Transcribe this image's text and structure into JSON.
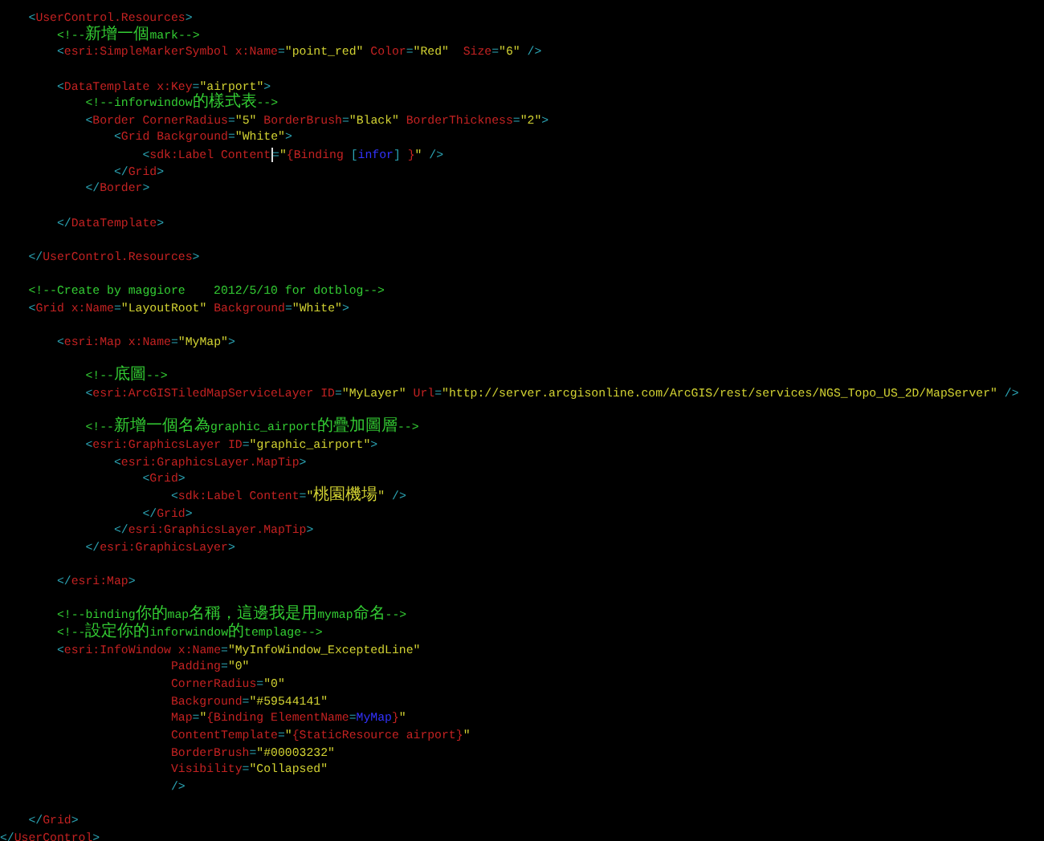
{
  "editor": {
    "lines": [
      {
        "kind": "code",
        "segments": [
          {
            "kind": "punct",
            "text": "    <"
          },
          {
            "kind": "tag",
            "text": "UserControl.Resources"
          },
          {
            "kind": "punct",
            "text": ">"
          }
        ]
      },
      {
        "kind": "code",
        "segments": [
          {
            "kind": "comment",
            "text": "        <!--新增一個mark-->"
          }
        ]
      },
      {
        "kind": "code",
        "segments": [
          {
            "kind": "punct",
            "text": "        <"
          },
          {
            "kind": "tag",
            "text": "esri:SimpleMarkerSymbol"
          },
          {
            "kind": "attr",
            "text": " x:Name"
          },
          {
            "kind": "punct",
            "text": "="
          },
          {
            "kind": "value",
            "text": "\"point_red\""
          },
          {
            "kind": "attr",
            "text": " Color"
          },
          {
            "kind": "punct",
            "text": "="
          },
          {
            "kind": "value",
            "text": "\"Red\""
          },
          {
            "kind": "attr",
            "text": "  Size"
          },
          {
            "kind": "punct",
            "text": "="
          },
          {
            "kind": "value",
            "text": "\"6\""
          },
          {
            "kind": "punct",
            "text": " />"
          }
        ]
      },
      {
        "kind": "blank"
      },
      {
        "kind": "code",
        "segments": [
          {
            "kind": "punct",
            "text": "        <"
          },
          {
            "kind": "tag",
            "text": "DataTemplate"
          },
          {
            "kind": "attr",
            "text": " x:Key"
          },
          {
            "kind": "punct",
            "text": "="
          },
          {
            "kind": "value",
            "text": "\"airport\""
          },
          {
            "kind": "punct",
            "text": ">"
          }
        ]
      },
      {
        "kind": "code",
        "segments": [
          {
            "kind": "comment",
            "text": "            <!--inforwindow的樣式表-->"
          }
        ]
      },
      {
        "kind": "code",
        "segments": [
          {
            "kind": "punct",
            "text": "            <"
          },
          {
            "kind": "tag",
            "text": "Border"
          },
          {
            "kind": "attr",
            "text": " CornerRadius"
          },
          {
            "kind": "punct",
            "text": "="
          },
          {
            "kind": "value",
            "text": "\"5\""
          },
          {
            "kind": "attr",
            "text": " BorderBrush"
          },
          {
            "kind": "punct",
            "text": "="
          },
          {
            "kind": "value",
            "text": "\"Black\""
          },
          {
            "kind": "attr",
            "text": " BorderThickness"
          },
          {
            "kind": "punct",
            "text": "="
          },
          {
            "kind": "value",
            "text": "\"2\""
          },
          {
            "kind": "punct",
            "text": ">"
          }
        ]
      },
      {
        "kind": "code",
        "segments": [
          {
            "kind": "punct",
            "text": "                <"
          },
          {
            "kind": "tag",
            "text": "Grid"
          },
          {
            "kind": "attr",
            "text": " Background"
          },
          {
            "kind": "punct",
            "text": "="
          },
          {
            "kind": "value",
            "text": "\"White\""
          },
          {
            "kind": "punct",
            "text": ">"
          }
        ]
      },
      {
        "kind": "code",
        "segments": [
          {
            "kind": "punct",
            "text": "                    <"
          },
          {
            "kind": "tag",
            "text": "sdk:Label"
          },
          {
            "kind": "attr",
            "text": " Content"
          },
          {
            "kind": "caret"
          },
          {
            "kind": "punct",
            "text": "="
          },
          {
            "kind": "value",
            "text": "\""
          },
          {
            "kind": "attr",
            "text": "{Binding "
          },
          {
            "kind": "punct",
            "text": "["
          },
          {
            "kind": "ref",
            "text": "infor"
          },
          {
            "kind": "punct",
            "text": "]"
          },
          {
            "kind": "attr",
            "text": " }"
          },
          {
            "kind": "value",
            "text": "\""
          },
          {
            "kind": "punct",
            "text": " />"
          }
        ]
      },
      {
        "kind": "code",
        "segments": [
          {
            "kind": "punct",
            "text": "                </"
          },
          {
            "kind": "tag",
            "text": "Grid"
          },
          {
            "kind": "punct",
            "text": ">"
          }
        ]
      },
      {
        "kind": "code",
        "segments": [
          {
            "kind": "punct",
            "text": "            </"
          },
          {
            "kind": "tag",
            "text": "Border"
          },
          {
            "kind": "punct",
            "text": ">"
          }
        ]
      },
      {
        "kind": "blank"
      },
      {
        "kind": "code",
        "segments": [
          {
            "kind": "punct",
            "text": "        </"
          },
          {
            "kind": "tag",
            "text": "DataTemplate"
          },
          {
            "kind": "punct",
            "text": ">"
          }
        ]
      },
      {
        "kind": "blank"
      },
      {
        "kind": "code",
        "segments": [
          {
            "kind": "punct",
            "text": "    </"
          },
          {
            "kind": "tag",
            "text": "UserControl.Resources"
          },
          {
            "kind": "punct",
            "text": ">"
          }
        ]
      },
      {
        "kind": "blank"
      },
      {
        "kind": "code",
        "segments": [
          {
            "kind": "comment",
            "text": "    <!--Create by maggiore    2012/5/10 for dotblog-->"
          }
        ]
      },
      {
        "kind": "code",
        "segments": [
          {
            "kind": "punct",
            "text": "    <"
          },
          {
            "kind": "tag",
            "text": "Grid"
          },
          {
            "kind": "attr",
            "text": " x:Name"
          },
          {
            "kind": "punct",
            "text": "="
          },
          {
            "kind": "value",
            "text": "\"LayoutRoot\""
          },
          {
            "kind": "attr",
            "text": " Background"
          },
          {
            "kind": "punct",
            "text": "="
          },
          {
            "kind": "value",
            "text": "\"White\""
          },
          {
            "kind": "punct",
            "text": ">"
          }
        ]
      },
      {
        "kind": "blank"
      },
      {
        "kind": "code",
        "segments": [
          {
            "kind": "punct",
            "text": "        <"
          },
          {
            "kind": "tag",
            "text": "esri:Map"
          },
          {
            "kind": "attr",
            "text": " x:Name"
          },
          {
            "kind": "punct",
            "text": "="
          },
          {
            "kind": "value",
            "text": "\"MyMap\""
          },
          {
            "kind": "punct",
            "text": ">"
          }
        ]
      },
      {
        "kind": "blank"
      },
      {
        "kind": "code",
        "segments": [
          {
            "kind": "comment",
            "text": "            <!--底圖-->"
          }
        ]
      },
      {
        "kind": "code",
        "segments": [
          {
            "kind": "punct",
            "text": "            <"
          },
          {
            "kind": "tag",
            "text": "esri:ArcGISTiledMapServiceLayer"
          },
          {
            "kind": "attr",
            "text": " ID"
          },
          {
            "kind": "punct",
            "text": "="
          },
          {
            "kind": "value",
            "text": "\"MyLayer\""
          },
          {
            "kind": "attr",
            "text": " Url"
          },
          {
            "kind": "punct",
            "text": "="
          },
          {
            "kind": "value",
            "text": "\"http://server.arcgisonline.com/ArcGIS/rest/services/NGS_Topo_US_2D/MapServer\""
          },
          {
            "kind": "punct",
            "text": " />"
          }
        ]
      },
      {
        "kind": "blank"
      },
      {
        "kind": "code",
        "segments": [
          {
            "kind": "comment",
            "text": "            <!--新增一個名為graphic_airport的疊加圖層-->"
          }
        ]
      },
      {
        "kind": "code",
        "segments": [
          {
            "kind": "punct",
            "text": "            <"
          },
          {
            "kind": "tag",
            "text": "esri:GraphicsLayer"
          },
          {
            "kind": "attr",
            "text": " ID"
          },
          {
            "kind": "punct",
            "text": "="
          },
          {
            "kind": "value",
            "text": "\"graphic_airport\""
          },
          {
            "kind": "punct",
            "text": ">"
          }
        ]
      },
      {
        "kind": "code",
        "segments": [
          {
            "kind": "punct",
            "text": "                <"
          },
          {
            "kind": "tag",
            "text": "esri:GraphicsLayer.MapTip"
          },
          {
            "kind": "punct",
            "text": ">"
          }
        ]
      },
      {
        "kind": "code",
        "segments": [
          {
            "kind": "punct",
            "text": "                    <"
          },
          {
            "kind": "tag",
            "text": "Grid"
          },
          {
            "kind": "punct",
            "text": ">"
          }
        ]
      },
      {
        "kind": "code",
        "segments": [
          {
            "kind": "punct",
            "text": "                        <"
          },
          {
            "kind": "tag",
            "text": "sdk:Label"
          },
          {
            "kind": "attr",
            "text": " Content"
          },
          {
            "kind": "punct",
            "text": "="
          },
          {
            "kind": "value",
            "text": "\"桃園機場\""
          },
          {
            "kind": "punct",
            "text": " />"
          }
        ]
      },
      {
        "kind": "code",
        "segments": [
          {
            "kind": "punct",
            "text": "                    </"
          },
          {
            "kind": "tag",
            "text": "Grid"
          },
          {
            "kind": "punct",
            "text": ">"
          }
        ]
      },
      {
        "kind": "code",
        "segments": [
          {
            "kind": "punct",
            "text": "                </"
          },
          {
            "kind": "tag",
            "text": "esri:GraphicsLayer.MapTip"
          },
          {
            "kind": "punct",
            "text": ">"
          }
        ]
      },
      {
        "kind": "code",
        "segments": [
          {
            "kind": "punct",
            "text": "            </"
          },
          {
            "kind": "tag",
            "text": "esri:GraphicsLayer"
          },
          {
            "kind": "punct",
            "text": ">"
          }
        ]
      },
      {
        "kind": "blank"
      },
      {
        "kind": "code",
        "segments": [
          {
            "kind": "punct",
            "text": "        </"
          },
          {
            "kind": "tag",
            "text": "esri:Map"
          },
          {
            "kind": "punct",
            "text": ">"
          }
        ]
      },
      {
        "kind": "blank"
      },
      {
        "kind": "code",
        "segments": [
          {
            "kind": "comment",
            "text": "        <!--binding你的map名稱，這邊我是用mymap命名-->"
          }
        ]
      },
      {
        "kind": "code",
        "segments": [
          {
            "kind": "comment",
            "text": "        <!--設定你的inforwindow的templage-->"
          }
        ]
      },
      {
        "kind": "code",
        "segments": [
          {
            "kind": "punct",
            "text": "        <"
          },
          {
            "kind": "tag",
            "text": "esri:InfoWindow"
          },
          {
            "kind": "attr",
            "text": " x:Name"
          },
          {
            "kind": "punct",
            "text": "="
          },
          {
            "kind": "value",
            "text": "\"MyInfoWindow_ExceptedLine\""
          }
        ]
      },
      {
        "kind": "code",
        "segments": [
          {
            "kind": "attr",
            "text": "                        Padding"
          },
          {
            "kind": "punct",
            "text": "="
          },
          {
            "kind": "value",
            "text": "\"0\""
          }
        ]
      },
      {
        "kind": "code",
        "segments": [
          {
            "kind": "attr",
            "text": "                        CornerRadius"
          },
          {
            "kind": "punct",
            "text": "="
          },
          {
            "kind": "value",
            "text": "\"0\""
          }
        ]
      },
      {
        "kind": "code",
        "segments": [
          {
            "kind": "attr",
            "text": "                        Background"
          },
          {
            "kind": "punct",
            "text": "="
          },
          {
            "kind": "value",
            "text": "\"#59544141\""
          }
        ]
      },
      {
        "kind": "code",
        "segments": [
          {
            "kind": "attr",
            "text": "                        Map"
          },
          {
            "kind": "punct",
            "text": "="
          },
          {
            "kind": "value",
            "text": "\""
          },
          {
            "kind": "attr",
            "text": "{Binding ElementName"
          },
          {
            "kind": "punct",
            "text": "="
          },
          {
            "kind": "ref",
            "text": "MyMap"
          },
          {
            "kind": "attr",
            "text": "}"
          },
          {
            "kind": "value",
            "text": "\""
          }
        ]
      },
      {
        "kind": "code",
        "segments": [
          {
            "kind": "attr",
            "text": "                        ContentTemplate"
          },
          {
            "kind": "punct",
            "text": "="
          },
          {
            "kind": "value",
            "text": "\""
          },
          {
            "kind": "attr",
            "text": "{StaticResource airport}"
          },
          {
            "kind": "value",
            "text": "\""
          }
        ]
      },
      {
        "kind": "code",
        "segments": [
          {
            "kind": "attr",
            "text": "                        BorderBrush"
          },
          {
            "kind": "punct",
            "text": "="
          },
          {
            "kind": "value",
            "text": "\"#00003232\""
          }
        ]
      },
      {
        "kind": "code",
        "segments": [
          {
            "kind": "attr",
            "text": "                        Visibility"
          },
          {
            "kind": "punct",
            "text": "="
          },
          {
            "kind": "value",
            "text": "\"Collapsed\""
          }
        ]
      },
      {
        "kind": "code",
        "segments": [
          {
            "kind": "punct",
            "text": "                        />"
          }
        ]
      },
      {
        "kind": "blank"
      },
      {
        "kind": "code",
        "segments": [
          {
            "kind": "punct",
            "text": "    </"
          },
          {
            "kind": "tag",
            "text": "Grid"
          },
          {
            "kind": "punct",
            "text": ">"
          }
        ]
      },
      {
        "kind": "code",
        "segments": [
          {
            "kind": "punct",
            "text": "</"
          },
          {
            "kind": "tag",
            "text": "UserControl"
          },
          {
            "kind": "punct",
            "text": ">"
          }
        ]
      }
    ]
  }
}
